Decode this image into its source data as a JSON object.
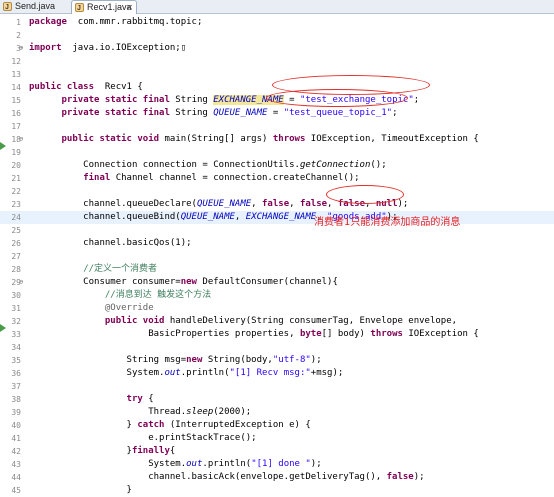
{
  "tabs": [
    {
      "label": "Send.java",
      "active": false
    },
    {
      "label": "Recv1.java",
      "active": true,
      "close": "✕"
    }
  ],
  "annotation_note": "消费者1只能消费添加商品的消息",
  "lines": [
    {
      "n": "1",
      "segs": [
        [
          "kw",
          "package"
        ],
        [
          "",
          "  com.mmr.rabbitmq.topic;"
        ]
      ]
    },
    {
      "n": "2",
      "segs": []
    },
    {
      "n": "3",
      "fold": "+",
      "segs": [
        [
          "kw",
          "import"
        ],
        [
          "",
          "  java.io.IOException;"
        ],
        [
          "",
          "▯"
        ]
      ]
    },
    {
      "n": "12",
      "segs": []
    },
    {
      "n": "13",
      "segs": []
    },
    {
      "n": "14",
      "segs": [
        [
          "kw",
          "public class"
        ],
        [
          "",
          "  Recv1 {"
        ]
      ]
    },
    {
      "n": "15",
      "segs": [
        [
          "",
          "      "
        ],
        [
          "kw",
          "private static final"
        ],
        [
          "",
          " String "
        ],
        [
          "fldh",
          "EXCHANGE_NAME"
        ],
        [
          "",
          " = "
        ],
        [
          "str",
          "\"test_exchange_topic\""
        ],
        [
          "",
          ";"
        ]
      ]
    },
    {
      "n": "16",
      "segs": [
        [
          "",
          "      "
        ],
        [
          "kw",
          "private static final"
        ],
        [
          "",
          " String "
        ],
        [
          "fld",
          "QUEUE_NAME"
        ],
        [
          "",
          " = "
        ],
        [
          "str",
          "\"test_queue_topic_1\""
        ],
        [
          "",
          ";"
        ]
      ]
    },
    {
      "n": "17",
      "segs": []
    },
    {
      "n": "18",
      "fold": "-",
      "marker": "override",
      "segs": [
        [
          "",
          "      "
        ],
        [
          "kw",
          "public static void"
        ],
        [
          "",
          " main(String[] args) "
        ],
        [
          "kw",
          "throws"
        ],
        [
          "",
          " IOException, TimeoutException {"
        ]
      ]
    },
    {
      "n": "19",
      "segs": []
    },
    {
      "n": "20",
      "segs": [
        [
          "",
          "          Connection connection = ConnectionUtils."
        ],
        [
          "ital",
          "getConnection"
        ],
        [
          "",
          "();"
        ]
      ]
    },
    {
      "n": "21",
      "segs": [
        [
          "",
          "          "
        ],
        [
          "kw",
          "final"
        ],
        [
          "",
          " Channel channel = connection.createChannel();"
        ]
      ]
    },
    {
      "n": "22",
      "segs": []
    },
    {
      "n": "23",
      "segs": [
        [
          "",
          "          channel.queueDeclare("
        ],
        [
          "fld",
          "QUEUE_NAME"
        ],
        [
          "",
          ", "
        ],
        [
          "kw",
          "false"
        ],
        [
          "",
          ", "
        ],
        [
          "kw",
          "false"
        ],
        [
          "",
          ", "
        ],
        [
          "kw",
          "false"
        ],
        [
          "",
          ", "
        ],
        [
          "kw",
          "null"
        ],
        [
          "",
          ");"
        ]
      ]
    },
    {
      "n": "24",
      "hl": true,
      "segs": [
        [
          "",
          "          channel.queueBind("
        ],
        [
          "fld",
          "QUEUE_NAME"
        ],
        [
          "",
          ", "
        ],
        [
          "fld",
          "EXCHANGE_NAME"
        ],
        [
          "",
          ", "
        ],
        [
          "str",
          "\"goods.add\""
        ],
        [
          "",
          ");"
        ]
      ]
    },
    {
      "n": "25",
      "segs": []
    },
    {
      "n": "26",
      "segs": [
        [
          "",
          "          channel.basicQos(1);"
        ]
      ]
    },
    {
      "n": "27",
      "segs": []
    },
    {
      "n": "28",
      "segs": [
        [
          "",
          "          "
        ],
        [
          "cmt",
          "//定义一个消费者"
        ]
      ]
    },
    {
      "n": "29",
      "fold": "-",
      "segs": [
        [
          "",
          "          Consumer consumer="
        ],
        [
          "kw",
          "new"
        ],
        [
          "",
          " DefaultConsumer(channel){"
        ]
      ]
    },
    {
      "n": "30",
      "segs": [
        [
          "",
          "              "
        ],
        [
          "cmt",
          "//消息到达 触发这个方法"
        ]
      ]
    },
    {
      "n": "31",
      "segs": [
        [
          "",
          "              "
        ],
        [
          "ann",
          "@Override"
        ]
      ]
    },
    {
      "n": "32",
      "marker": "override",
      "segs": [
        [
          "",
          "              "
        ],
        [
          "kw",
          "public void"
        ],
        [
          "",
          " handleDelivery(String consumerTag, Envelope envelope,"
        ]
      ]
    },
    {
      "n": "33",
      "segs": [
        [
          "",
          "                      BasicProperties properties, "
        ],
        [
          "kw",
          "byte"
        ],
        [
          "",
          "[] body) "
        ],
        [
          "kw",
          "throws"
        ],
        [
          "",
          " IOException {"
        ]
      ]
    },
    {
      "n": "34",
      "segs": []
    },
    {
      "n": "35",
      "segs": [
        [
          "",
          "                  String msg="
        ],
        [
          "kw",
          "new"
        ],
        [
          "",
          " String(body,"
        ],
        [
          "str",
          "\"utf-8\""
        ],
        [
          "",
          ");"
        ]
      ]
    },
    {
      "n": "36",
      "segs": [
        [
          "",
          "                  System."
        ],
        [
          "out",
          "out"
        ],
        [
          "",
          ".println("
        ],
        [
          "str",
          "\"[1] Recv msg:\""
        ],
        [
          "",
          "+msg);"
        ]
      ]
    },
    {
      "n": "37",
      "segs": []
    },
    {
      "n": "38",
      "segs": [
        [
          "",
          "                  "
        ],
        [
          "kw",
          "try"
        ],
        [
          "",
          " {"
        ]
      ]
    },
    {
      "n": "39",
      "segs": [
        [
          "",
          "                      Thread."
        ],
        [
          "ital",
          "sleep"
        ],
        [
          "",
          "(2000);"
        ]
      ]
    },
    {
      "n": "40",
      "segs": [
        [
          "",
          "                  } "
        ],
        [
          "kw",
          "catch"
        ],
        [
          "",
          " (InterruptedException e) {"
        ]
      ]
    },
    {
      "n": "41",
      "segs": [
        [
          "",
          "                      e.printStackTrace();"
        ]
      ]
    },
    {
      "n": "42",
      "segs": [
        [
          "",
          "                  }"
        ],
        [
          "kw",
          "finally"
        ],
        [
          "",
          "{"
        ]
      ]
    },
    {
      "n": "43",
      "segs": [
        [
          "",
          "                      System."
        ],
        [
          "out",
          "out"
        ],
        [
          "",
          ".println("
        ],
        [
          "str",
          "\"[1] done \""
        ],
        [
          "",
          ");"
        ]
      ]
    },
    {
      "n": "44",
      "segs": [
        [
          "",
          "                      channel.basicAck(envelope.getDeliveryTag(), "
        ],
        [
          "kw",
          "false"
        ],
        [
          "",
          ");"
        ]
      ]
    },
    {
      "n": "45",
      "segs": [
        [
          "",
          "                  }"
        ]
      ]
    }
  ]
}
